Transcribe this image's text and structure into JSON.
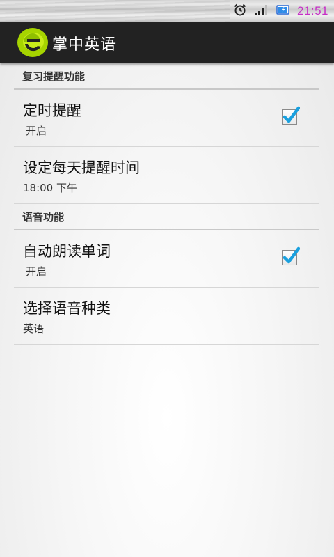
{
  "status_bar": {
    "time": "21:51",
    "icons": [
      "alarm-icon",
      "signal-icon",
      "battery-icon"
    ],
    "time_color": "#c62fc6"
  },
  "action_bar": {
    "logo_icon": "app-logo-e-icon",
    "title": "掌中英语"
  },
  "sections": {
    "review": {
      "header": "复习提醒功能",
      "items": [
        {
          "title": "定时提醒",
          "summary": "开启",
          "checked": true
        },
        {
          "title": "设定每天提醒时间",
          "summary": "18:00 下午"
        }
      ]
    },
    "voice": {
      "header": "语音功能",
      "items": [
        {
          "title": "自动朗读单词",
          "summary": "开启",
          "checked": true
        },
        {
          "title": "选择语音种类",
          "summary": "英语"
        }
      ]
    }
  },
  "colors": {
    "accent_check": "#1aa0de",
    "action_bar": "#222222",
    "logo_green": "#a6d400"
  }
}
